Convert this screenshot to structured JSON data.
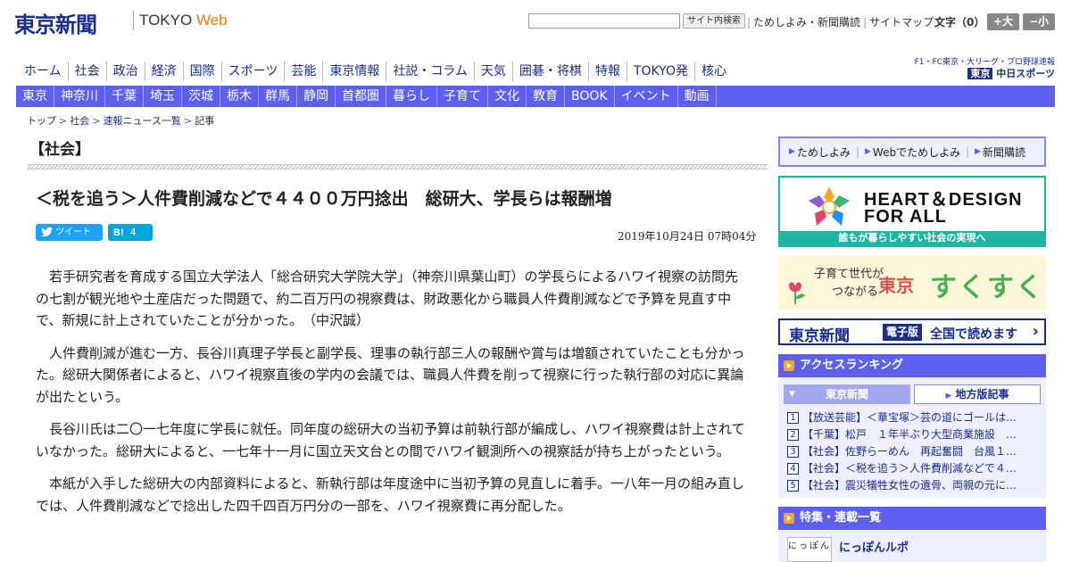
{
  "header": {
    "logo_jp": "東京新聞",
    "logo_en_prefix": "TOKYO",
    "logo_en_suffix": "Web",
    "search_button": "サイト内検索",
    "links": [
      "ためしよみ・新聞購読",
      "サイトマップ"
    ],
    "font_size_label": "文字（0）",
    "font_larger": "+大",
    "font_smaller": "−小"
  },
  "main_nav": [
    "ホーム",
    "社会",
    "政治",
    "経済",
    "国際",
    "スポーツ",
    "芸能",
    "東京情報",
    "社説・コラム",
    "天気",
    "囲碁・将棋",
    "特報",
    "TOKYO発",
    "核心"
  ],
  "chunichi": {
    "line1": "F1・FC東京・大リーグ・プロ野球速報",
    "prefix": "東京",
    "name": "中日スポーツ"
  },
  "sub_nav": [
    "東京",
    "神奈川",
    "千葉",
    "埼玉",
    "茨城",
    "栃木",
    "群馬",
    "静岡",
    "首都圏",
    "暮らし",
    "子育て",
    "文化",
    "教育",
    "BOOK",
    "イベント",
    "動画"
  ],
  "breadcrumb": [
    "トップ",
    "社会",
    "速報ニュース一覧",
    "記事"
  ],
  "section_label": "【社会】",
  "article": {
    "headline": "＜税を追う＞人件費削減などで４４００万円捻出　総研大、学長らは報酬増",
    "tweet_label": "ツイート",
    "hatebu_label": "B!",
    "hatebu_count": "4",
    "timestamp": "2019年10月24日 07時04分",
    "paragraphs": [
      "若手研究者を育成する国立大学法人「総合研究大学院大学」（神奈川県葉山町）の学長らによるハワイ視察の訪問先の七割が観光地や土産店だった問題で、約二百万円の視察費は、財政悪化から職員人件費削減などで予算を見直す中で、新規に計上されていたことが分かった。　（中沢誠）",
      "人件費削減が進む一方、長谷川真理子学長と副学長、理事の執行部三人の報酬や賞与は増額されていたことも分かった。総研大関係者によると、ハワイ視察直後の学内の会議では、職員人件費を削って視察に行った執行部の対応に異論が出たという。",
      "長谷川氏は二〇一七年度に学長に就任。同年度の総研大の当初予算は前執行部が編成し、ハワイ視察費は計上されていなかった。総研大によると、一七年十一月に国立天文台との間でハワイ観測所への視察話が持ち上がったという。",
      "本紙が入手した総研大の内部資料によると、新執行部は年度途中に当初予算の見直しに着手。一八年一月の組み直しでは、人件費削減などで捻出した四千四百万円分の一部を、ハワイ視察費に再分配した。"
    ]
  },
  "sidebar": {
    "promo_links": [
      "ためしよみ",
      "Webでためしよみ",
      "新聞購読"
    ],
    "heart_title1": "HEART＆DESIGN",
    "heart_title2": "FOR ALL",
    "heart_footer": "誰もが暮らしやすい社会の実現へ",
    "suku_line1": "子育て世代が",
    "suku_line2": "つながる",
    "suku_tokyo": "東京",
    "suku_name": "すくすく",
    "denshi_logo": "東京新聞",
    "denshi_tag": "電子版",
    "denshi_text": "全国で読めます",
    "ranking_title": "アクセスランキング",
    "ranking_tab_active": "東京新聞",
    "ranking_tab_other": "地方版記事",
    "ranking": [
      {
        "num": "1",
        "text": "【放送芸能】＜華宝塚＞芸の道にゴールは…"
      },
      {
        "num": "2",
        "text": "【千葉】松戸　１年半ぶり大型商業施設　…"
      },
      {
        "num": "3",
        "text": "【社会】佐野らーめん　再起奮闘　台風１…"
      },
      {
        "num": "4",
        "text": "【社会】＜税を追う＞人件費削減などで４…"
      },
      {
        "num": "5",
        "text": "【社会】震災犠牲女性の遺骨、両親の元に…"
      }
    ],
    "feature_title": "特集・連載一覧",
    "feature_thumb": "にっぽん",
    "feature_item": "にっぽんルポ"
  }
}
